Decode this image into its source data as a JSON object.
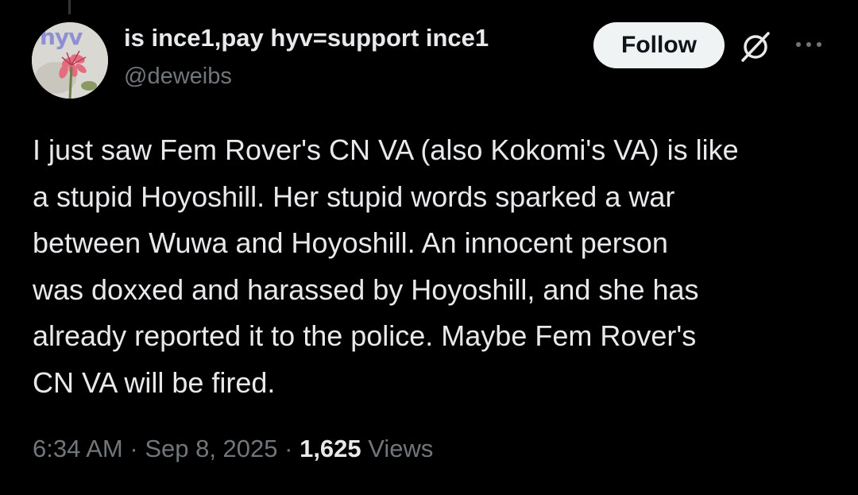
{
  "user": {
    "display_name": "is ince1,pay hyv=support ince1",
    "handle": "@deweibs",
    "avatar_text": "hyv"
  },
  "actions": {
    "follow_label": "Follow",
    "grok_icon": "grok-icon",
    "more_icon": "more-options-icon"
  },
  "post": {
    "lines": [
      "I just saw Fem Rover's CN VA (also Kokomi's VA) is like",
      "a stupid Hoyoshill. Her stupid words sparked a war",
      "between Wuwa and Hoyoshill. An innocent person",
      "was doxxed and harassed by Hoyoshill, and she has",
      "already reported it to the police. Maybe Fem Rover's",
      "CN VA will be fired."
    ]
  },
  "meta": {
    "time": "6:34 AM",
    "separator": " · ",
    "date": "Sep 8, 2025",
    "views_count": "1,625",
    "views_label": " Views"
  },
  "colors": {
    "background": "#000000",
    "primary_text": "#e7e9ea",
    "secondary_text": "#71767b",
    "follow_bg": "#eff3f4"
  }
}
